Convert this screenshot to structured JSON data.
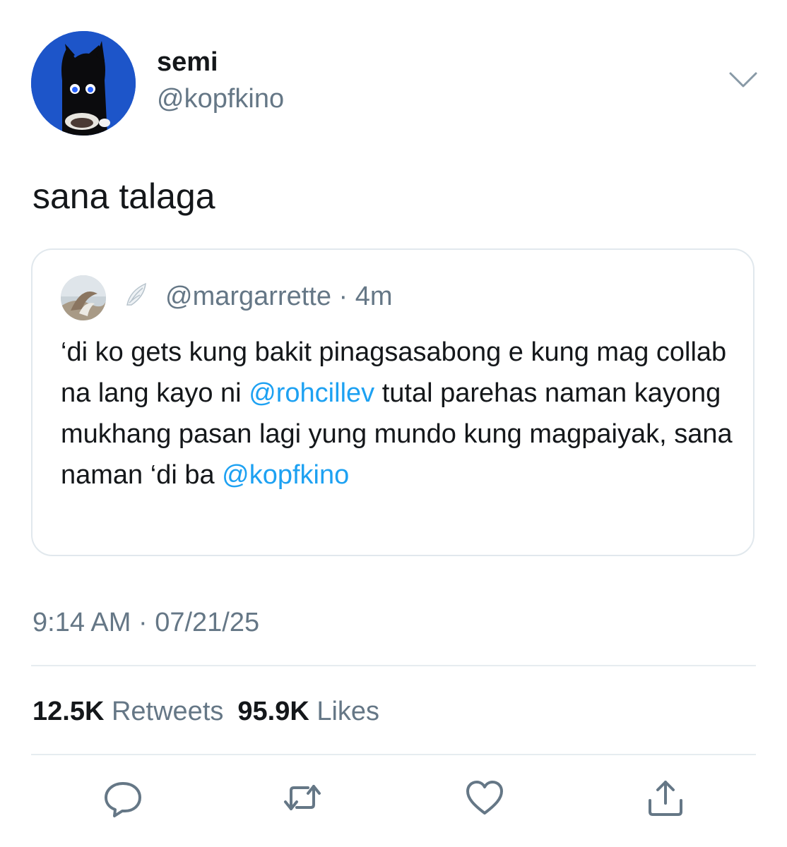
{
  "tweet": {
    "author": {
      "display_name": "semi",
      "handle": "@kopfkino"
    },
    "text": "sana talaga",
    "quoted": {
      "handle": "@margarrette",
      "separator": "·",
      "time_ago": "4m",
      "text_parts": [
        "‘di ko gets kung bakit pinagsasabong e kung mag collab na lang kayo ni ",
        "@rohcillev",
        " tutal parehas naman kayong mukhang pasan lagi yung mundo kung magpaiyak, sana naman ‘di ba ",
        "@kopfkino"
      ]
    },
    "timestamp": "9:14 AM · 07/21/25",
    "stats": {
      "retweets_count": "12.5K",
      "retweets_label": "Retweets",
      "likes_count": "95.9K",
      "likes_label": "Likes"
    }
  },
  "colors": {
    "text": "#14171a",
    "secondary": "#657786",
    "mention": "#1da1f2",
    "border": "#e1e8ed",
    "avatar_bg": "#1d55c9"
  },
  "icons": {
    "caret": "chevron-down-icon",
    "reply": "reply-icon",
    "retweet": "retweet-icon",
    "like": "heart-icon",
    "share": "share-icon",
    "wing": "wing-emoji-icon"
  }
}
